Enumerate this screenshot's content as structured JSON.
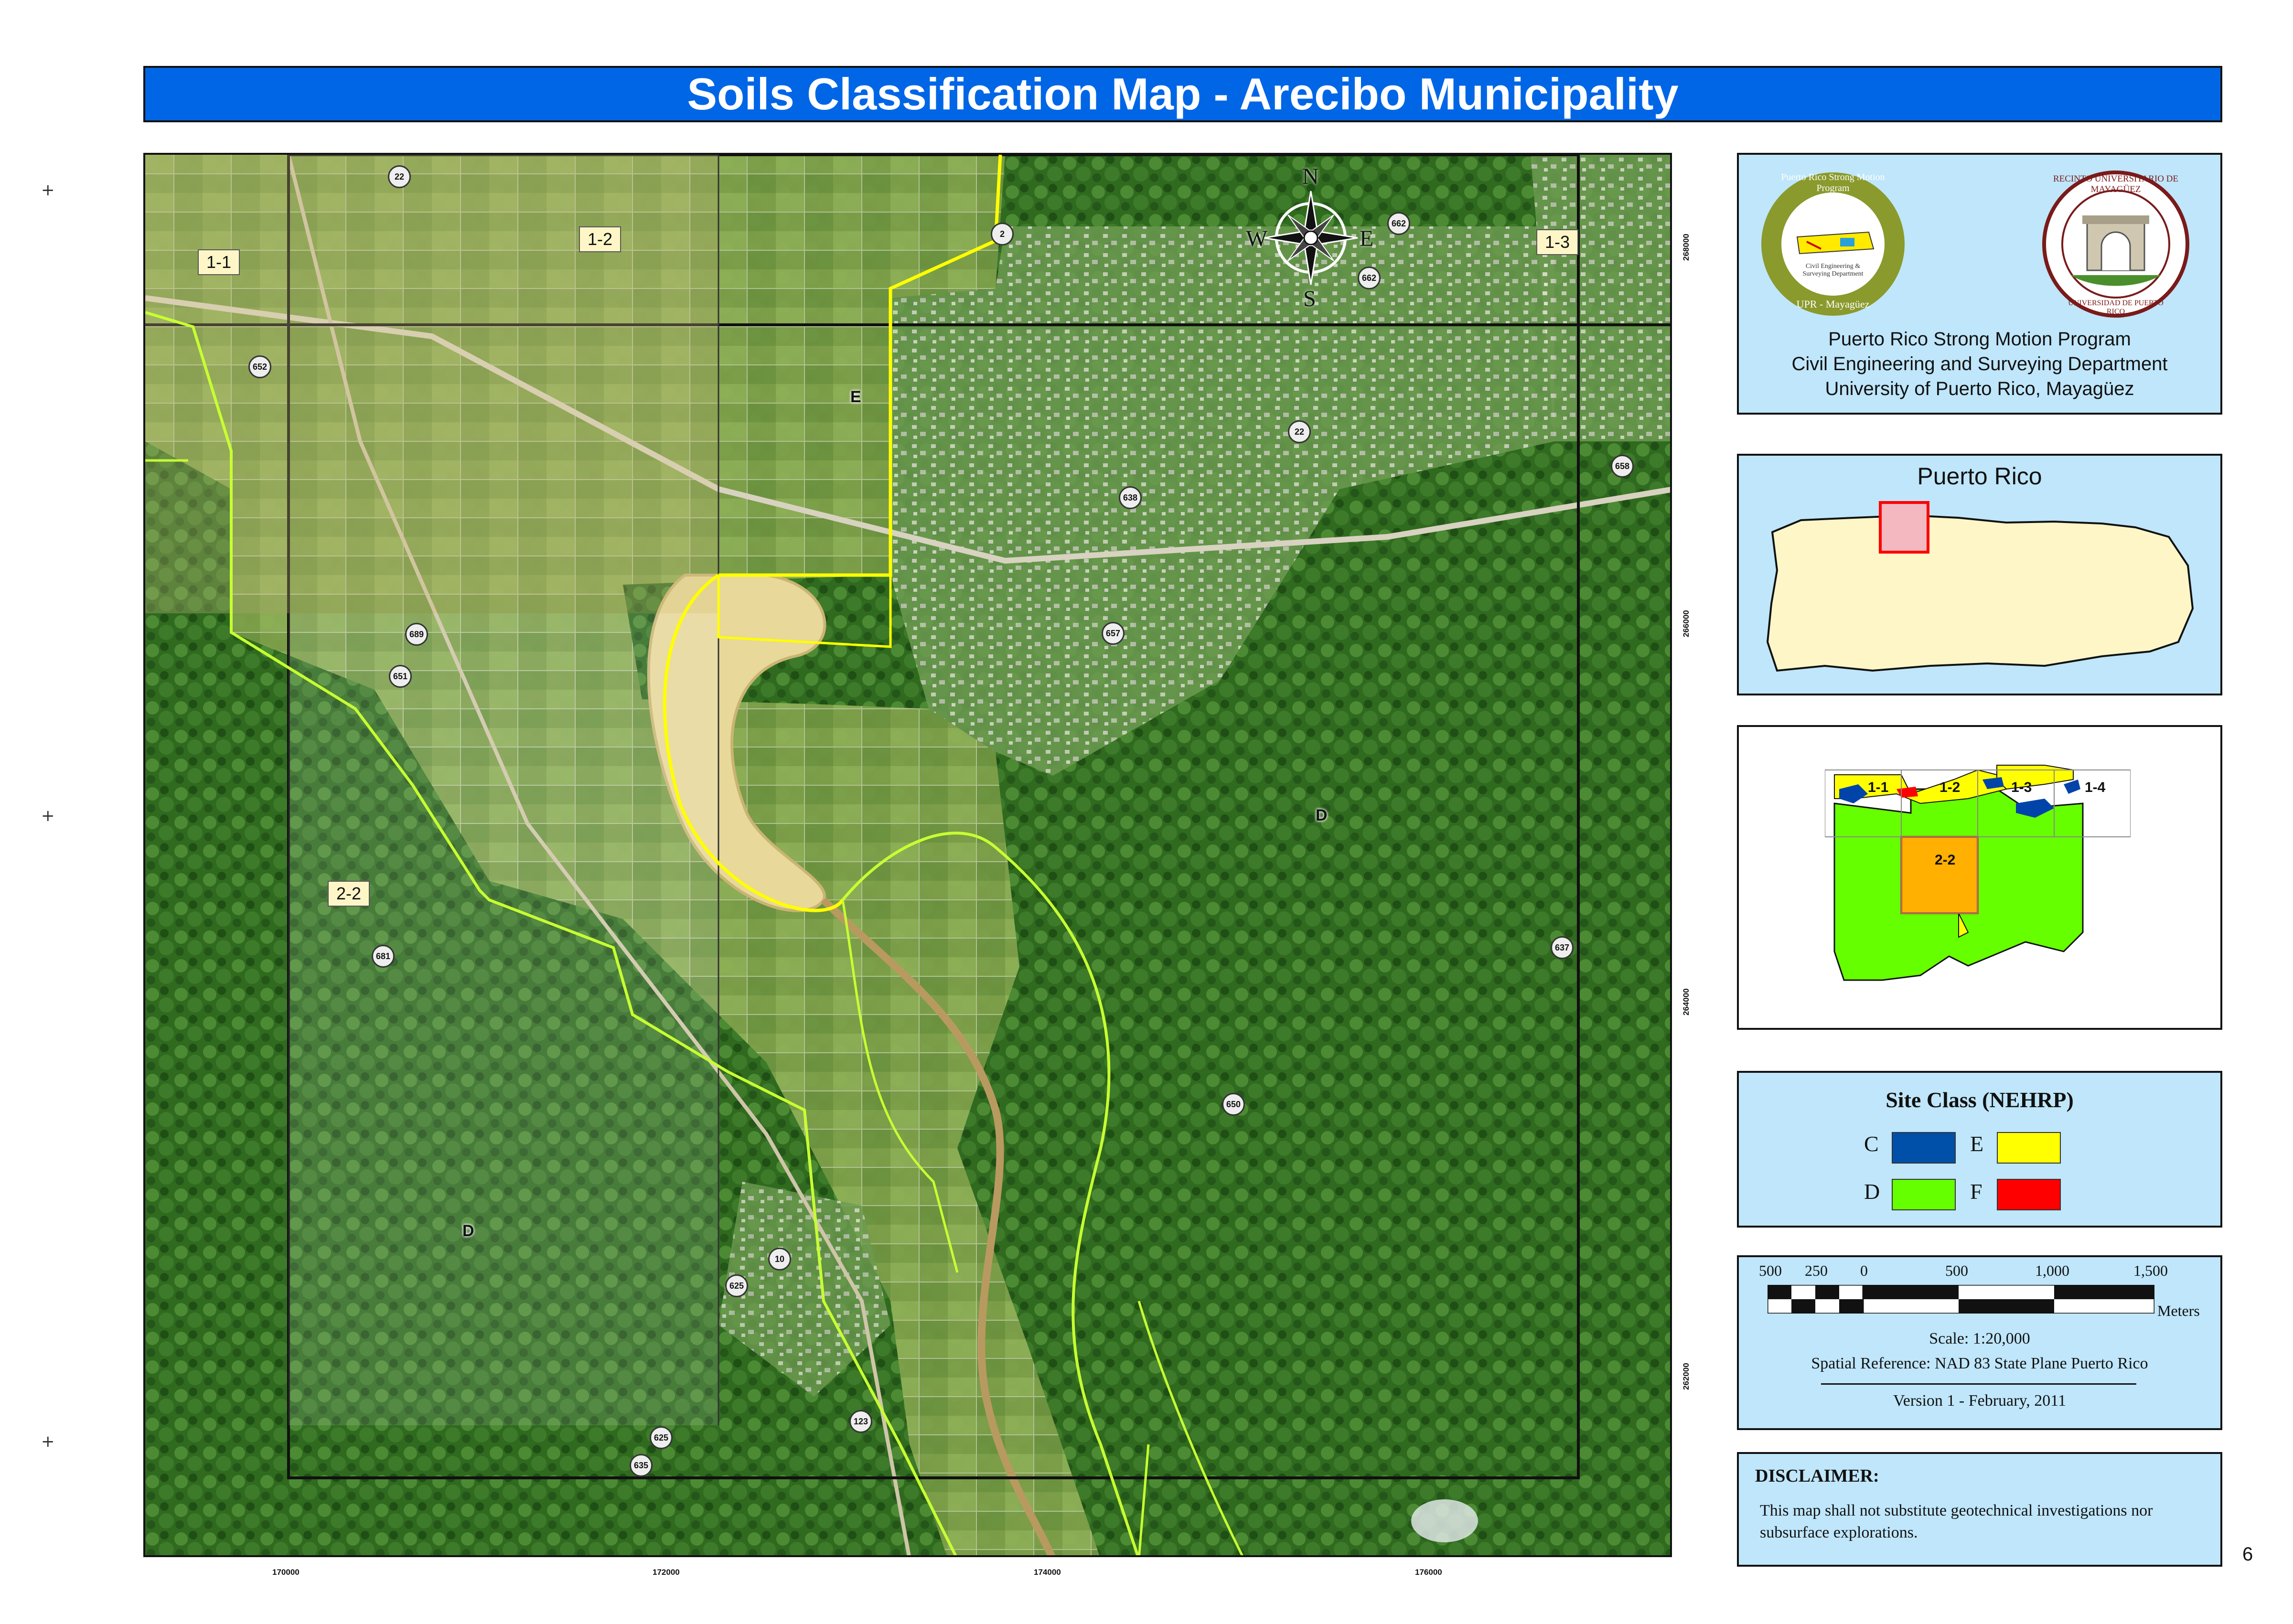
{
  "title": "Soils Classification Map - Arecibo Municipality",
  "map": {
    "x_ticks": [
      "170000",
      "172000",
      "174000",
      "176000"
    ],
    "y_ticks": [
      "268000",
      "266000",
      "264000",
      "262000"
    ],
    "grid_labels": [
      "1-1",
      "1-2",
      "1-3",
      "2-2"
    ],
    "class_labels": [
      "E",
      "D",
      "D"
    ],
    "road_numbers": [
      "22",
      "2",
      "662",
      "662",
      "652",
      "22",
      "658",
      "638",
      "689",
      "651",
      "657",
      "681",
      "637",
      "650",
      "10",
      "625",
      "123",
      "625",
      "635"
    ],
    "compass": {
      "n": "N",
      "s": "S",
      "e": "E",
      "w": "W"
    },
    "colors": {
      "class_e_boundary": "#ffff00",
      "class_d_boundary": "#b8ff3c"
    }
  },
  "info_panel": {
    "logo1_text": "Puerto Rico Strong Motion Program",
    "logo1_sub": "Civil Engineering & Surveying Department",
    "logo1_bottom": "UPR - Mayagüez",
    "logo2_text": "RECINTO UNIVERSITARIO DE MAYAGÜEZ",
    "logo2_bottom": "UNIVERSIDAD DE PUERTO RICO",
    "line1": "Puerto Rico Strong Motion Program",
    "line2": "Civil Engineering and Surveying Department",
    "line3": "University of Puerto Rico, Mayagüez"
  },
  "locator": {
    "title": "Puerto Rico",
    "colors": {
      "island": "#fff6c8",
      "highlight": "#ff0000"
    }
  },
  "index_map": {
    "labels": [
      "1-1",
      "1-2",
      "1-3",
      "1-4",
      "2-2"
    ],
    "colors": {
      "d": "#66ff00",
      "e": "#ffff00",
      "c": "#0044aa",
      "f": "#ff0000"
    }
  },
  "legend": {
    "title": "Site Class (NEHRP)",
    "items": [
      {
        "label": "C",
        "color": "#0050aa"
      },
      {
        "label": "E",
        "color": "#ffff00"
      },
      {
        "label": "D",
        "color": "#66ff00"
      },
      {
        "label": "F",
        "color": "#ff0000"
      }
    ]
  },
  "scale": {
    "ticks": [
      "500",
      "250",
      "0",
      "500",
      "1,000",
      "1,500"
    ],
    "units": "Meters",
    "scale_text": "Scale:  1:20,000",
    "spatial_ref": "Spatial Reference: NAD 83 State Plane Puerto Rico",
    "version": "Version 1 - February, 2011"
  },
  "disclaimer": {
    "title": "DISCLAIMER:",
    "body": "This  map shall not substitute geotechnical investigations nor subsurface explorations."
  },
  "page_number": "6",
  "margin_marks": [
    "+",
    "+",
    "+"
  ]
}
